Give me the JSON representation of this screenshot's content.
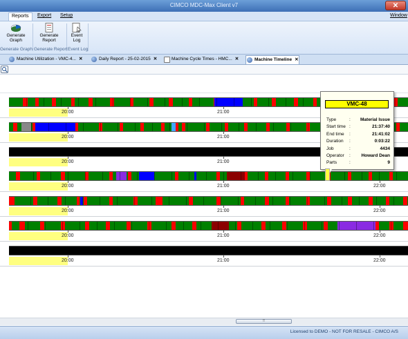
{
  "window": {
    "title": "CIMCO MDC-Max Client v7",
    "close_glyph": "✕"
  },
  "menu": {
    "reports": "Reports",
    "export": "Export",
    "setup": "Setup",
    "window": "Window"
  },
  "ribbon": {
    "generate_graph": [
      "Generate",
      "Graph"
    ],
    "generate_report": [
      "Generate",
      "Report"
    ],
    "event_log": [
      "Event",
      "Log"
    ],
    "groups": [
      "Generate Graph",
      "Generate Report",
      "Event Log"
    ]
  },
  "tabs": [
    {
      "label": "Machine Utilization - VMC-4...",
      "close": "✕"
    },
    {
      "label": "Daily Report - 25-02-2015",
      "close": "✕"
    },
    {
      "label": "Machine Cycle Times - HMC...",
      "close": "✕"
    },
    {
      "label": "Machine Timeline",
      "close": "✕"
    }
  ],
  "toolbar": {
    "search_glyph": "🔍"
  },
  "timeline": {
    "time_labels": [
      "20:00",
      "21:00",
      "22:00"
    ],
    "colors": {
      "running": "#008000",
      "stop": "#ff0000",
      "off": "#000000",
      "setup": "#0000ff",
      "blocked": "#8b0000",
      "purple": "#8a2be2",
      "grey": "#888888",
      "light_blue": "#3fa7ff"
    },
    "rows": [
      {
        "state": "green",
        "show22": false
      },
      {
        "state": "green",
        "show22": false
      },
      {
        "state": "black",
        "show22": false
      },
      {
        "state": "green",
        "show22": true
      },
      {
        "state": "green",
        "show22": true
      },
      {
        "state": "green",
        "show22": true
      },
      {
        "state": "black",
        "show22": true
      }
    ]
  },
  "tooltip": {
    "machine": "VMC-48",
    "fields": [
      {
        "key": "Type",
        "colon": ":",
        "value": "Material Issue"
      },
      {
        "key": "Start time",
        "colon": ":",
        "value": "21:37:40"
      },
      {
        "key": "End time",
        "colon": ":",
        "value": "21:41:02"
      },
      {
        "key": "Duration",
        "colon": ":",
        "value": "0:03:22"
      },
      {
        "key": "Job",
        "colon": ":",
        "value": "4434"
      },
      {
        "key": "Operator",
        "colon": ":",
        "value": "Howard Dean"
      },
      {
        "key": "Parts",
        "colon": ":",
        "value": "9"
      }
    ]
  },
  "scrollbar": {
    "grip": "⠿"
  },
  "status": {
    "license": "Licensed to DEMO - NOT FOR RESALE - CIMCO A/S"
  }
}
